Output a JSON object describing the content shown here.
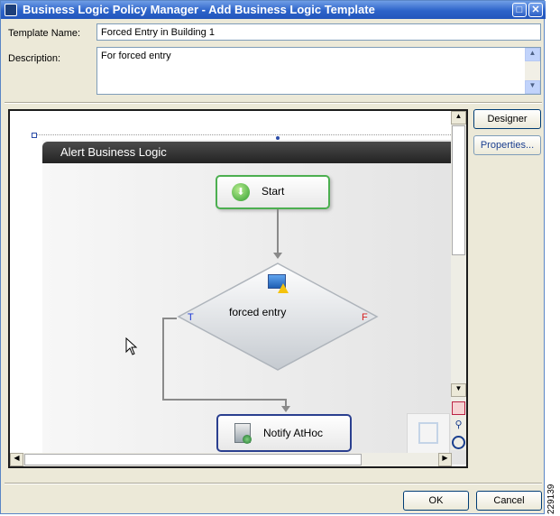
{
  "window": {
    "title": "Business Logic Policy Manager - Add Business Logic Template"
  },
  "form": {
    "template_name_label": "Template Name:",
    "template_name_value": "Forced Entry in Building 1",
    "description_label": "Description:",
    "description_value": "For forced entry"
  },
  "side_buttons": {
    "designer": "Designer",
    "properties": "Properties..."
  },
  "designer": {
    "panel_title": "Alert Business Logic",
    "start_label": "Start",
    "decision_label": "forced entry",
    "true_label": "T",
    "false_label": "F",
    "notify_label": "Notify AtHoc"
  },
  "footer": {
    "ok": "OK",
    "cancel": "Cancel"
  },
  "figure_id": "229139"
}
